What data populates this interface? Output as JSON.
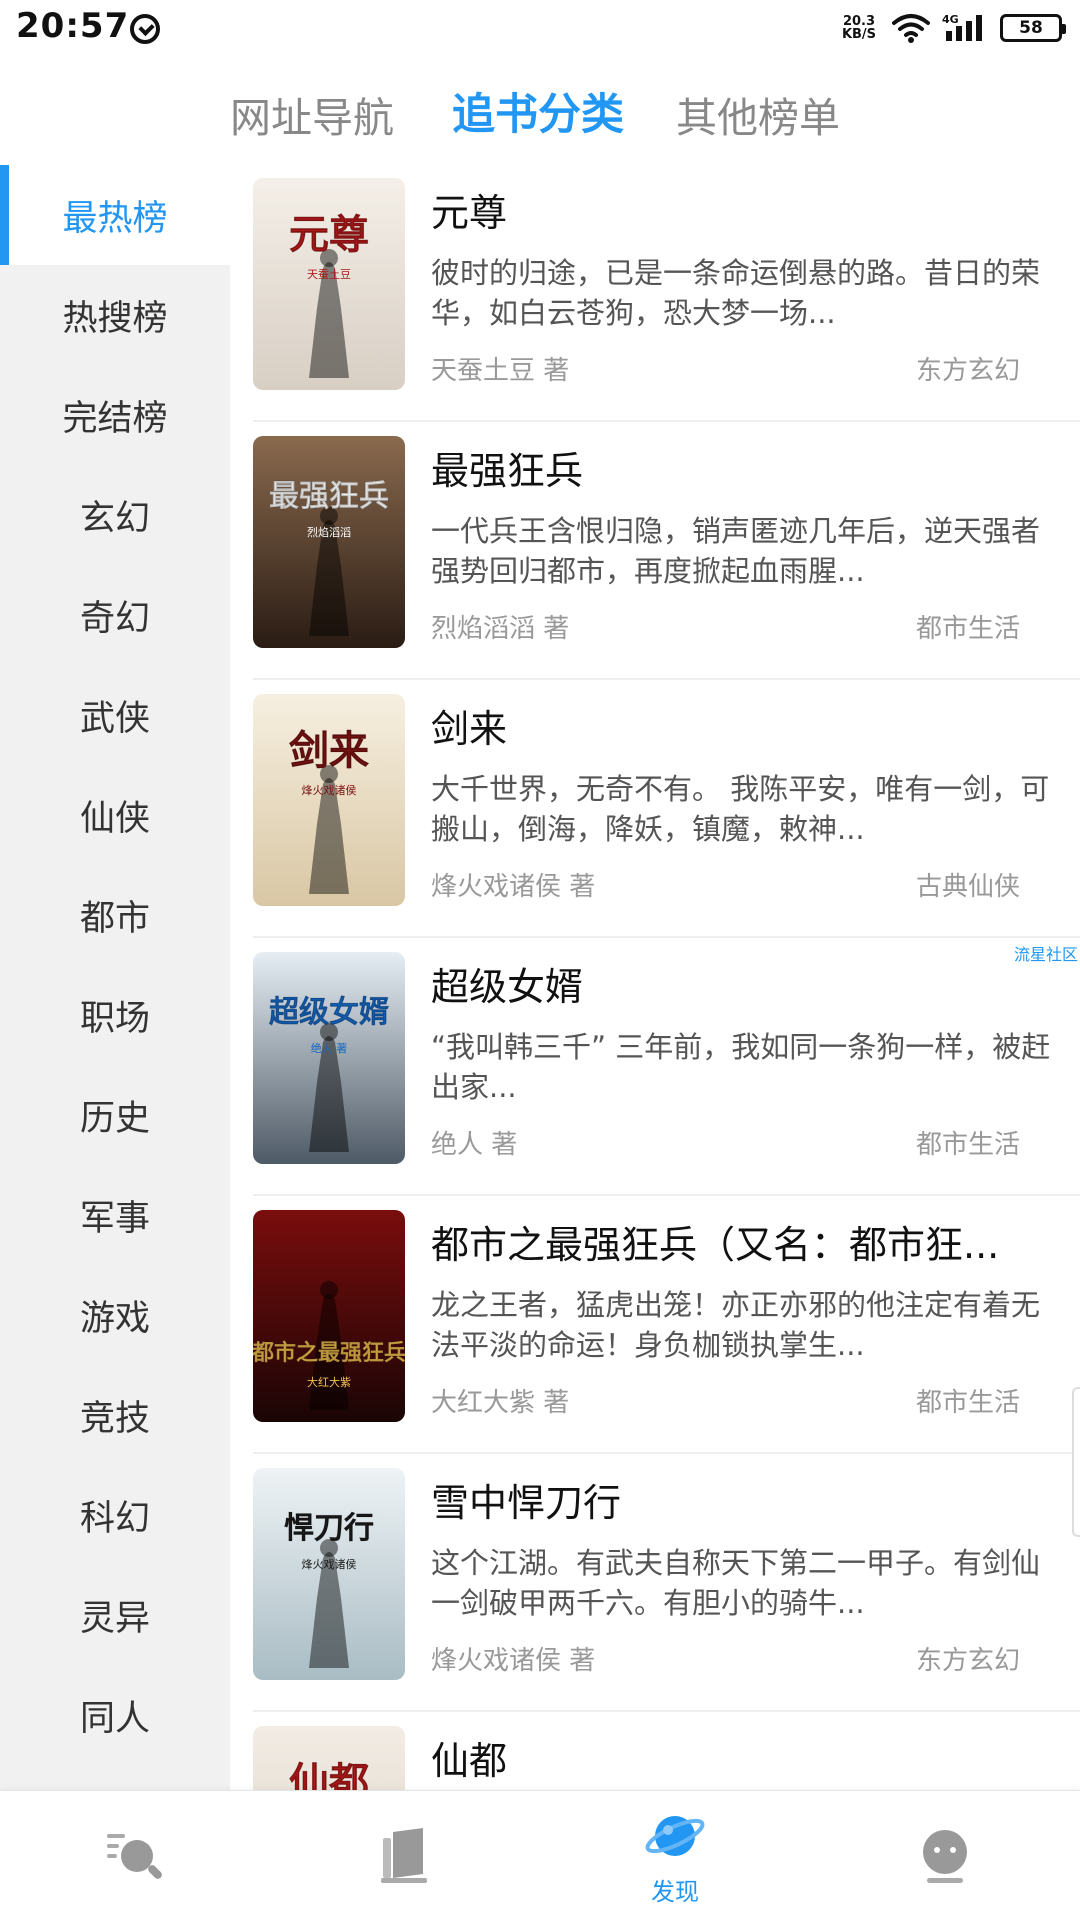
{
  "status_bar": {
    "time": "20:57",
    "net_speed_value": "20.3",
    "net_speed_unit": "KB/S",
    "battery": "58"
  },
  "top_tabs": [
    {
      "label": "网址导航",
      "active": false
    },
    {
      "label": "追书分类",
      "active": true
    },
    {
      "label": "其他榜单",
      "active": false
    }
  ],
  "sidebar": {
    "items": [
      {
        "label": "最热榜",
        "active": true
      },
      {
        "label": "热搜榜",
        "active": false
      },
      {
        "label": "完结榜",
        "active": false
      },
      {
        "label": "玄幻",
        "active": false
      },
      {
        "label": "奇幻",
        "active": false
      },
      {
        "label": "武侠",
        "active": false
      },
      {
        "label": "仙侠",
        "active": false
      },
      {
        "label": "都市",
        "active": false
      },
      {
        "label": "职场",
        "active": false
      },
      {
        "label": "历史",
        "active": false
      },
      {
        "label": "军事",
        "active": false
      },
      {
        "label": "游戏",
        "active": false
      },
      {
        "label": "竞技",
        "active": false
      },
      {
        "label": "科幻",
        "active": false
      },
      {
        "label": "灵异",
        "active": false
      },
      {
        "label": "同人",
        "active": false
      }
    ]
  },
  "books": [
    {
      "title": "元尊",
      "description": "彼时的归途，已是一条命运倒悬的路。昔日的荣华，如白云苍狗，恐大梦一场...",
      "author": "天蚕土豆 著",
      "genre": "东方玄幻",
      "cover": {
        "title_text": "元尊",
        "author_text": "天蚕土豆",
        "bg_top": "#f4efe8",
        "bg_bottom": "#d8cfc4",
        "accent": "#b01818"
      }
    },
    {
      "title": "最强狂兵",
      "description": "一代兵王含恨归隐，销声匿迹几年后，逆天强者强势回归都市，再度掀起血雨腥...",
      "author": "烈焰滔滔 著",
      "genre": "都市生活",
      "cover": {
        "title_text": "最强狂兵",
        "author_text": "烈焰滔滔",
        "bg_top": "#8a6a4e",
        "bg_bottom": "#2a1c14",
        "accent": "#ffffff"
      }
    },
    {
      "title": "剑来",
      "description": "大千世界，无奇不有。 我陈平安，唯有一剑，可搬山，倒海，降妖，镇魔，敕神...",
      "author": "烽火戏诸侯 著",
      "genre": "古典仙侠",
      "cover": {
        "title_text": "剑来",
        "author_text": "烽火戏诸侯",
        "bg_top": "#f6efe0",
        "bg_bottom": "#d9c7a4",
        "accent": "#7a1212"
      }
    },
    {
      "title": "超级女婿",
      "description": "“我叫韩三千” 三年前，我如同一条狗一样，被赶出家...",
      "author": "绝人 著",
      "genre": "都市生活",
      "cover": {
        "title_text": "超级女婿",
        "author_text": "绝人 著",
        "bg_top": "#e6eef4",
        "bg_bottom": "#4e5a66",
        "accent": "#1565c0"
      },
      "watermark": "流星社区"
    },
    {
      "title": "都市之最强狂兵（又名：都市狂...",
      "description": "龙之王者，猛虎出笼！亦正亦邪的他注定有着无法平淡的命运！身负枷锁执掌生...",
      "author": "大红大紫 著",
      "genre": "都市生活",
      "cover": {
        "title_text": "都市之最强狂兵",
        "author_text": "大红大紫",
        "bg_top": "#7a0d0d",
        "bg_bottom": "#1a0505",
        "accent": "#f2c14e"
      }
    },
    {
      "title": "雪中悍刀行",
      "description": "这个江湖。有武夫自称天下第二一甲子。有剑仙一剑破甲两千六。有胆小的骑牛...",
      "author": "烽火戏诸侯 著",
      "genre": "东方玄幻",
      "cover": {
        "title_text": "悍刀行",
        "author_text": "烽火戏诸侯",
        "bg_top": "#eef3f5",
        "bg_bottom": "#a9bcc4",
        "accent": "#1b1b1b"
      }
    },
    {
      "title": "仙都",
      "description": "",
      "author": "",
      "genre": "",
      "cover": {
        "title_text": "仙都",
        "author_text": "",
        "bg_top": "#f2ece4",
        "bg_bottom": "#d8d0c4",
        "accent": "#b01818"
      }
    }
  ],
  "bottom_nav": [
    {
      "label": "",
      "icon": "search-icon",
      "active": false
    },
    {
      "label": "",
      "icon": "bookshelf-icon",
      "active": false
    },
    {
      "label": "发现",
      "icon": "planet-icon",
      "active": true
    },
    {
      "label": "",
      "icon": "profile-icon",
      "active": false
    }
  ],
  "colors": {
    "accent": "#2196f3",
    "sidebar_bg": "#f1f1f1",
    "text_muted": "#999999",
    "icon_inactive": "#999999"
  }
}
